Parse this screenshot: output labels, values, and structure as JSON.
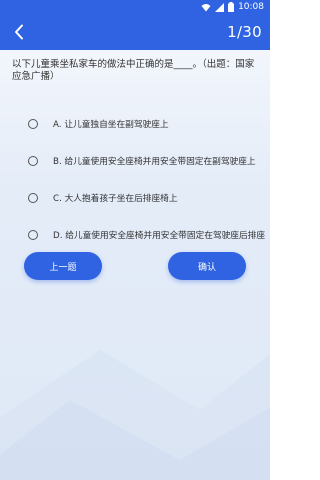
{
  "status_bar": {
    "time": "10:08",
    "icons": [
      "wifi-icon",
      "signal-icon",
      "battery-icon"
    ]
  },
  "header": {
    "back_icon": "chevron-left-icon",
    "counter": "1/30"
  },
  "question": {
    "text": "以下儿童乘坐私家车的做法中正确的是____。（出题：国家应急广播）"
  },
  "options": [
    {
      "label": "A. 让儿童独自坐在副驾驶座上"
    },
    {
      "label": "B. 给儿童使用安全座椅并用安全带固定在副驾驶座上"
    },
    {
      "label": "C. 大人抱着孩子坐在后排座椅上"
    },
    {
      "label": "D. 给儿童使用安全座椅并用安全带固定在驾驶座后排座"
    }
  ],
  "buttons": {
    "prev_label": "上一题",
    "confirm_label": "确认"
  },
  "colors": {
    "accent": "#2f63e1",
    "background": "#e8eef9"
  }
}
